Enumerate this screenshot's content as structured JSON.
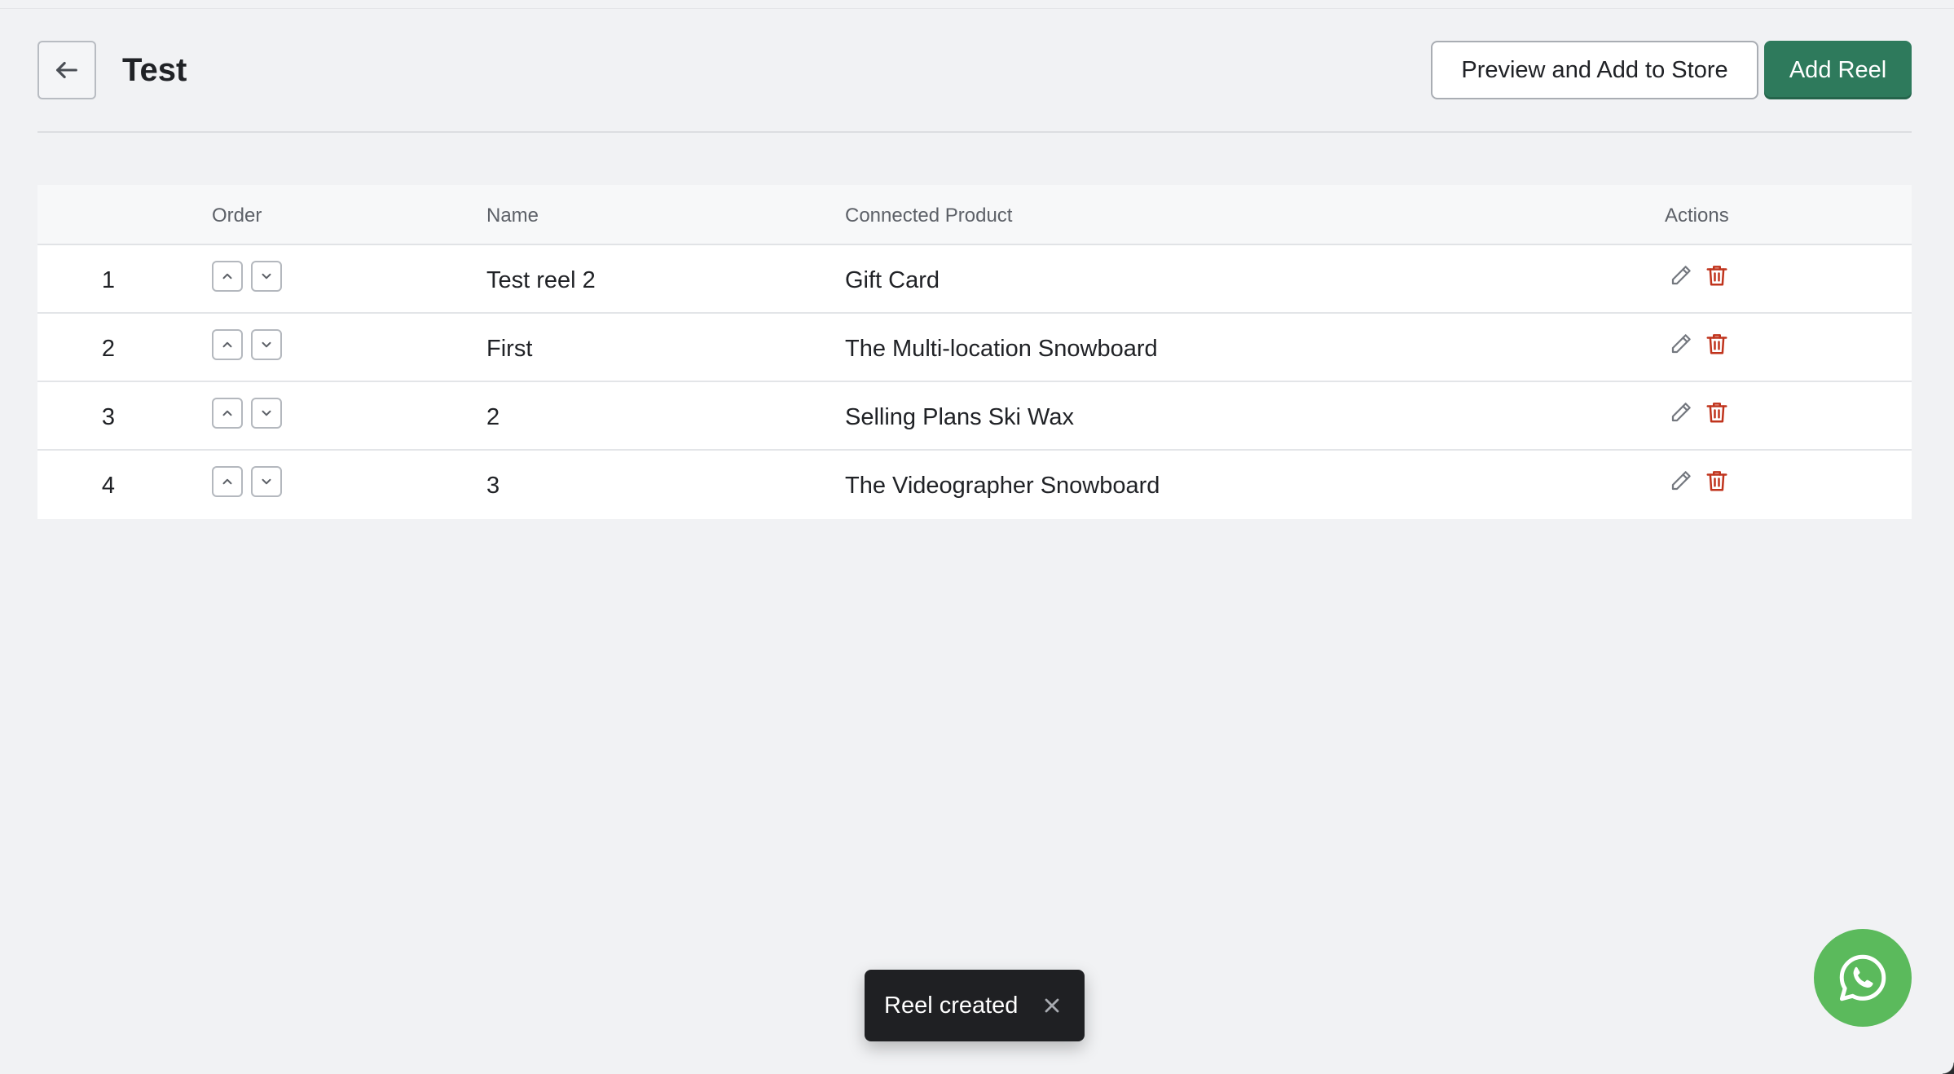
{
  "header": {
    "title": "Test",
    "preview_label": "Preview and Add to Store",
    "add_label": "Add Reel"
  },
  "table": {
    "columns": {
      "order": "Order",
      "name": "Name",
      "product": "Connected Product",
      "actions": "Actions"
    },
    "rows": [
      {
        "index": "1",
        "name": "Test reel 2",
        "product": "Gift Card"
      },
      {
        "index": "2",
        "name": "First",
        "product": "The Multi-location Snowboard"
      },
      {
        "index": "3",
        "name": "2",
        "product": "Selling Plans Ski Wax"
      },
      {
        "index": "4",
        "name": "3",
        "product": "The Videographer Snowboard"
      }
    ]
  },
  "toast": {
    "message": "Reel created"
  },
  "icons": {
    "back": "arrow-left-icon",
    "move_up": "chevron-up-icon",
    "move_down": "chevron-down-icon",
    "edit": "pencil-icon",
    "delete": "trash-icon",
    "close": "close-icon",
    "whatsapp": "whatsapp-icon"
  },
  "colors": {
    "primary_button": "#2e7a5c",
    "delete_icon": "#c0341d",
    "whatsapp": "#5bba5c",
    "toast_bg": "#1f2023"
  }
}
